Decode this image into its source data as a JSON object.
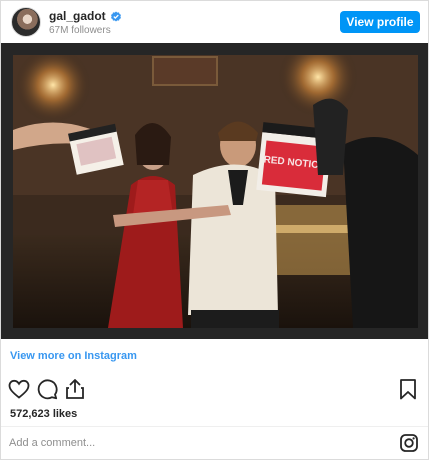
{
  "header": {
    "username": "gal_gadot",
    "followers": "67M followers",
    "view_profile_label": "View profile",
    "verified_color": "#3897f0",
    "button_color": "#0095f6"
  },
  "post": {
    "image_description_icon": "film-set-photo",
    "clapper_text": "RED NOTICE"
  },
  "footer": {
    "view_more_label": "View more on Instagram",
    "likes": "572,623 likes",
    "comment_placeholder": "Add a comment...",
    "icons": [
      "heart-icon",
      "comment-icon",
      "share-icon",
      "bookmark-icon",
      "instagram-icon"
    ]
  }
}
